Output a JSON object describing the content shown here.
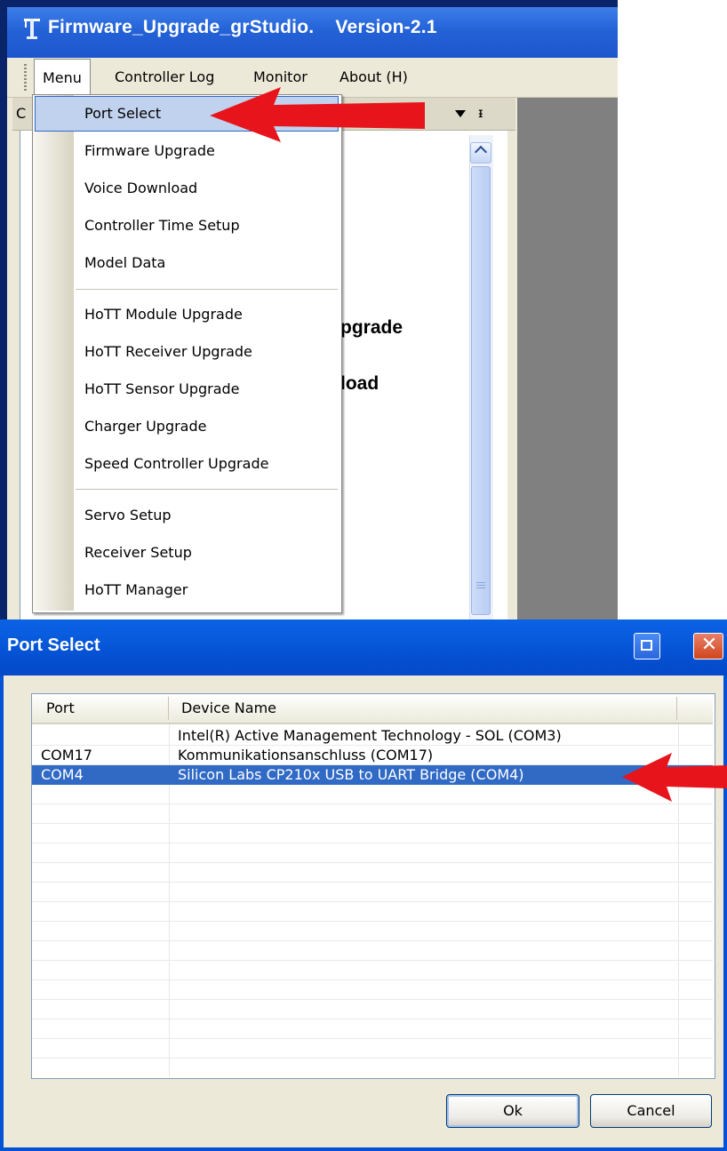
{
  "app": {
    "title": "Firmware_Upgrade_grStudio.    Version-2.1",
    "menubar": [
      "Menu",
      "Controller Log",
      "Monitor",
      "About (H)"
    ],
    "panel_header_letter": "C",
    "panel_text_1": "pgrade",
    "panel_text_2": "load"
  },
  "dropdown": {
    "items": [
      "Port Select",
      "Firmware Upgrade",
      "Voice Download",
      "Controller Time Setup",
      "Model Data",
      "HoTT Module Upgrade",
      "HoTT Receiver Upgrade",
      "HoTT Sensor Upgrade",
      "Charger Upgrade",
      "Speed Controller Upgrade",
      "Servo Setup",
      "Receiver Setup",
      "HoTT Manager"
    ],
    "highlighted": "Port Select"
  },
  "dialog": {
    "title": "Port Select",
    "columns": [
      "Port",
      "Device Name"
    ],
    "rows": [
      {
        "port": "",
        "device": "Intel(R) Active Management Technology - SOL (COM3)"
      },
      {
        "port": "COM17",
        "device": "Kommunikationsanschluss (COM17)"
      },
      {
        "port": "COM4",
        "device": "Silicon Labs CP210x USB to UART Bridge (COM4)"
      }
    ],
    "selected_row": "COM4",
    "ok_label": "Ok",
    "cancel_label": "Cancel"
  },
  "colors": {
    "titlebar_blue": "#0552d4",
    "selection_blue": "#316ac5",
    "menu_highlight": "#c1d2ee",
    "annotation_arrow": "#e8141b"
  },
  "icons": {
    "app": "crane-app-icon",
    "restore": "restore-window-icon",
    "close": "close-icon",
    "panel_dropdown": "triangle-down-icon",
    "panel_pin": "pin-icon",
    "scroll_up": "chevron-up-icon"
  }
}
